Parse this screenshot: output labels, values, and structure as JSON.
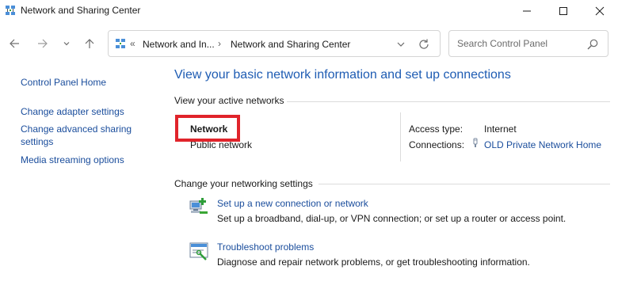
{
  "window": {
    "title": "Network and Sharing Center",
    "controls": {
      "minimize": "minimize-icon",
      "maximize": "maximize-icon",
      "close": "close-icon"
    }
  },
  "address": {
    "chevron": "«",
    "segments": [
      "Network and In...",
      "Network and Sharing Center"
    ],
    "separator": "›"
  },
  "search": {
    "placeholder": "Search Control Panel"
  },
  "sidebar": {
    "items": [
      {
        "label": "Control Panel Home"
      },
      {
        "label": "Change adapter settings"
      },
      {
        "label": "Change advanced sharing settings",
        "lines": [
          "Change advanced sharing",
          "settings"
        ]
      },
      {
        "label": "Media streaming options"
      }
    ]
  },
  "main": {
    "title": "View your basic network information and set up connections",
    "active_networks_label": "View your active networks",
    "network": {
      "name": "Network",
      "type": "Public network",
      "access_type_label": "Access type:",
      "access_type_value": "Internet",
      "connections_label": "Connections:",
      "connection_name": "OLD Private Network Home"
    },
    "change_settings_label": "Change your networking settings",
    "tasks": [
      {
        "icon": "new-connection-icon",
        "link": "Set up a new connection or network",
        "description": "Set up a broadband, dial-up, or VPN connection; or set up a router or access point."
      },
      {
        "icon": "troubleshoot-icon",
        "link": "Troubleshoot problems",
        "description": "Diagnose and repair network problems, or get troubleshooting information."
      }
    ]
  },
  "colors": {
    "link": "#1a4d9c",
    "title": "#1e5cb3",
    "highlight": "#e0242b"
  }
}
